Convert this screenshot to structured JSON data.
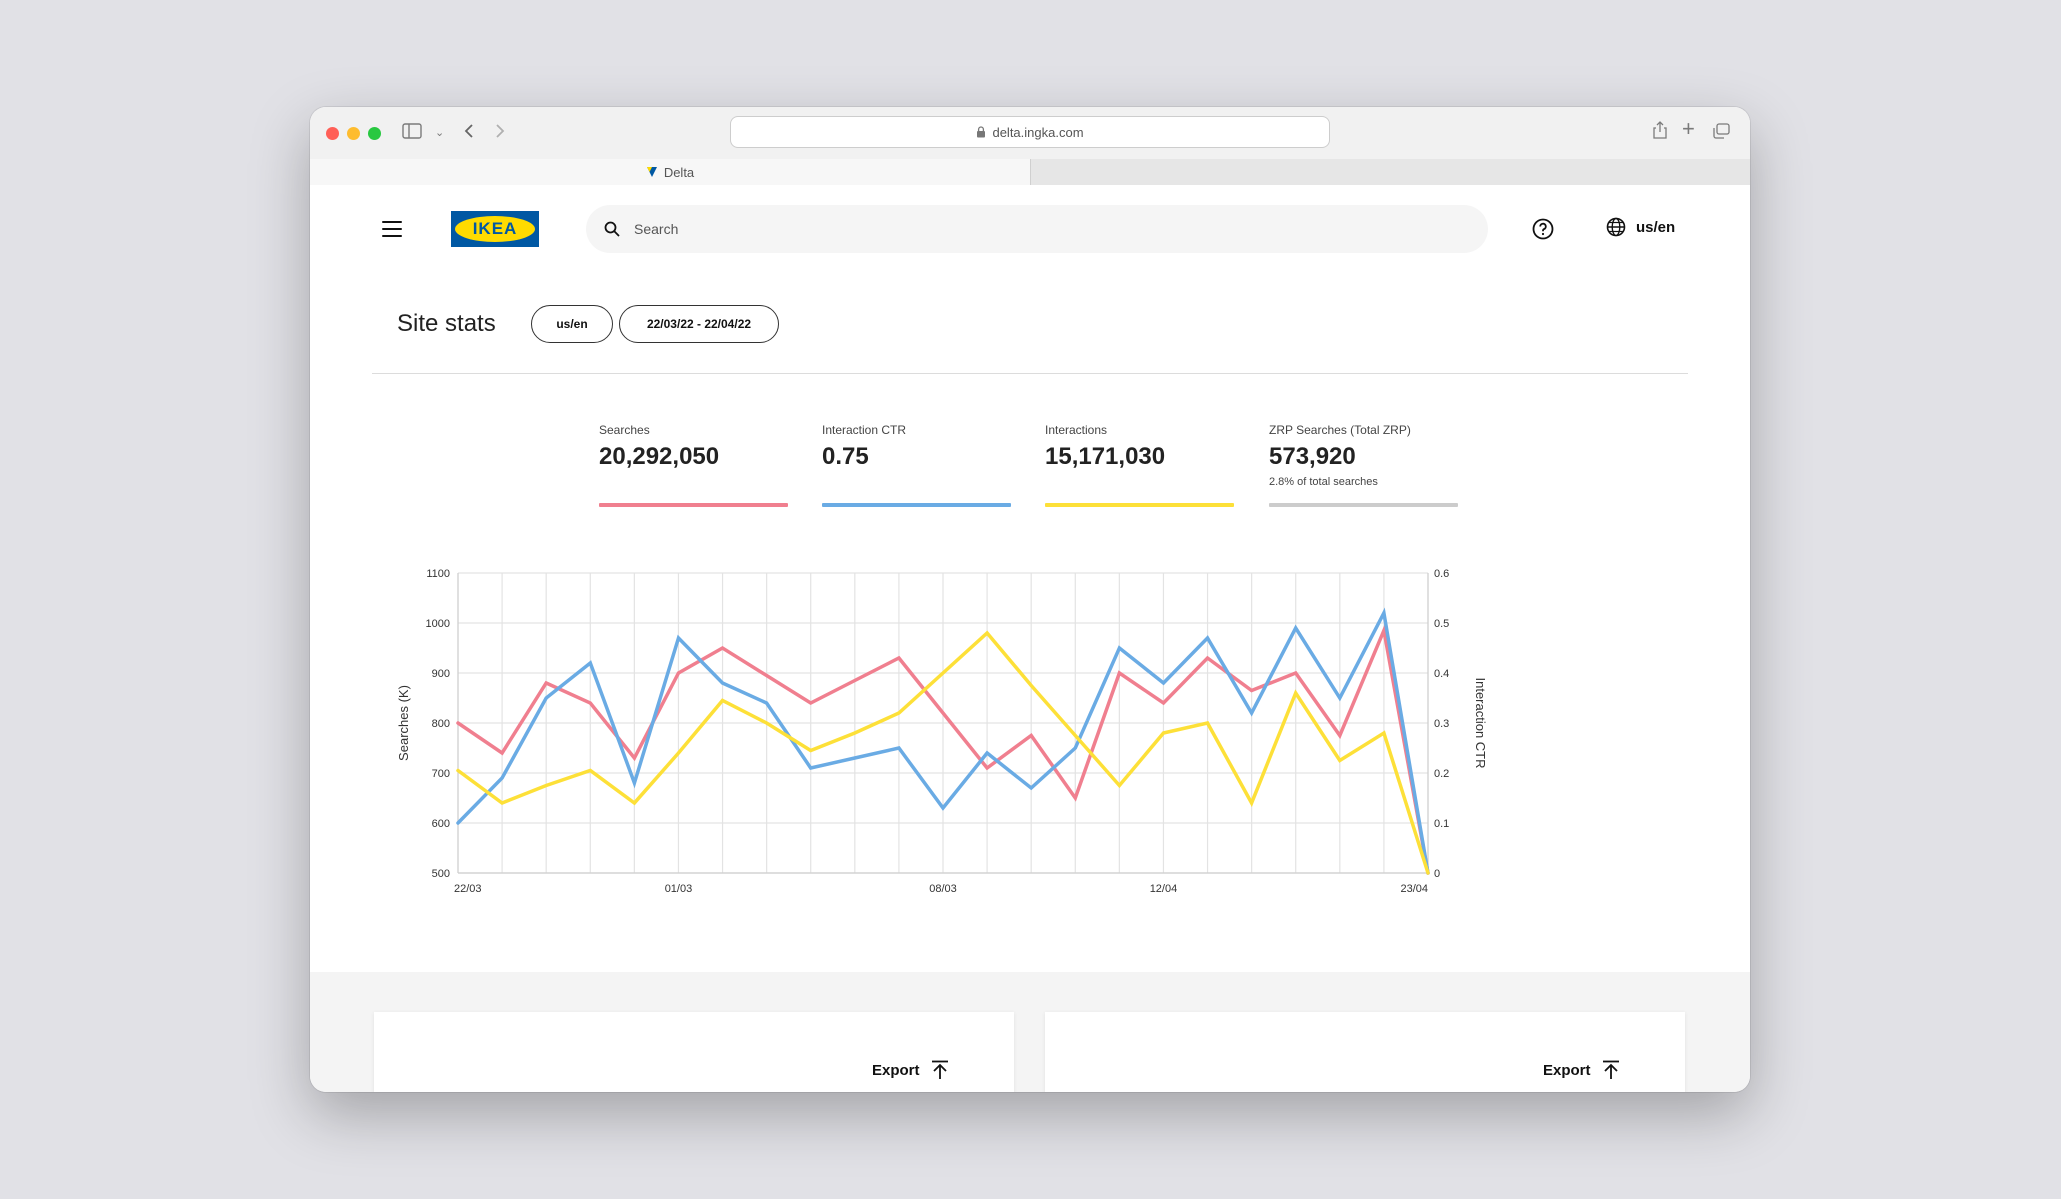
{
  "browser": {
    "url": "delta.ingka.com",
    "tab_title": "Delta"
  },
  "header": {
    "logo_text": "IKEA",
    "search_placeholder": "Search",
    "locale": "us/en"
  },
  "stats": {
    "title": "Site stats",
    "filter_locale": "us/en",
    "filter_dates": "22/03/22 - 22/04/22"
  },
  "metrics": [
    {
      "label": "Searches",
      "value": "20,292,050",
      "color": "#f07f8f"
    },
    {
      "label": "Interaction CTR",
      "value": "0.75",
      "color": "#6aabe4"
    },
    {
      "label": "Interactions",
      "value": "15,171,030",
      "color": "#fde038"
    },
    {
      "label": "ZRP Searches (Total ZRP)",
      "value": "573,920",
      "sub": "2.8% of total searches",
      "color": "#cccccc"
    }
  ],
  "chart_data": {
    "type": "line",
    "ylabel": "Searches (K)",
    "y2label": "Interaction CTR",
    "ylim": [
      500,
      1100
    ],
    "yticks": [
      500,
      600,
      700,
      800,
      900,
      1000,
      1100
    ],
    "y2lim": [
      0,
      0.6
    ],
    "y2ticks": [
      "0",
      "0.1",
      "0.2",
      "0.3",
      "0.4",
      "0.5",
      "0.6"
    ],
    "x_tick_labels": [
      {
        "index": 0,
        "label": "22/03"
      },
      {
        "index": 5,
        "label": "01/03"
      },
      {
        "index": 11,
        "label": "08/03"
      },
      {
        "index": 16,
        "label": "12/04"
      },
      {
        "index": 22,
        "label": "23/04"
      }
    ],
    "grid": true,
    "series": [
      {
        "key": "searches",
        "color": "#f07f8f",
        "axis": "left",
        "values": [
          800,
          740,
          880,
          840,
          730,
          900,
          950,
          895,
          840,
          885,
          930,
          820,
          710,
          775,
          650,
          900,
          840,
          930,
          865,
          900,
          775,
          985,
          500
        ]
      },
      {
        "key": "ctr",
        "color": "#6aabe4",
        "axis": "right",
        "values": [
          0.1,
          0.19,
          0.35,
          0.42,
          0.18,
          0.47,
          0.38,
          0.34,
          0.21,
          0.23,
          0.25,
          0.13,
          0.24,
          0.17,
          0.25,
          0.45,
          0.38,
          0.47,
          0.32,
          0.49,
          0.35,
          0.52,
          0
        ]
      },
      {
        "key": "interactions",
        "color": "#fde038",
        "axis": "left",
        "values": [
          705,
          640,
          675,
          705,
          640,
          740,
          845,
          800,
          745,
          780,
          820,
          900,
          980,
          875,
          775,
          675,
          780,
          800,
          640,
          860,
          725,
          780,
          500
        ]
      }
    ]
  },
  "cards": [
    {
      "export_label": "Export"
    },
    {
      "export_label": "Export"
    }
  ]
}
